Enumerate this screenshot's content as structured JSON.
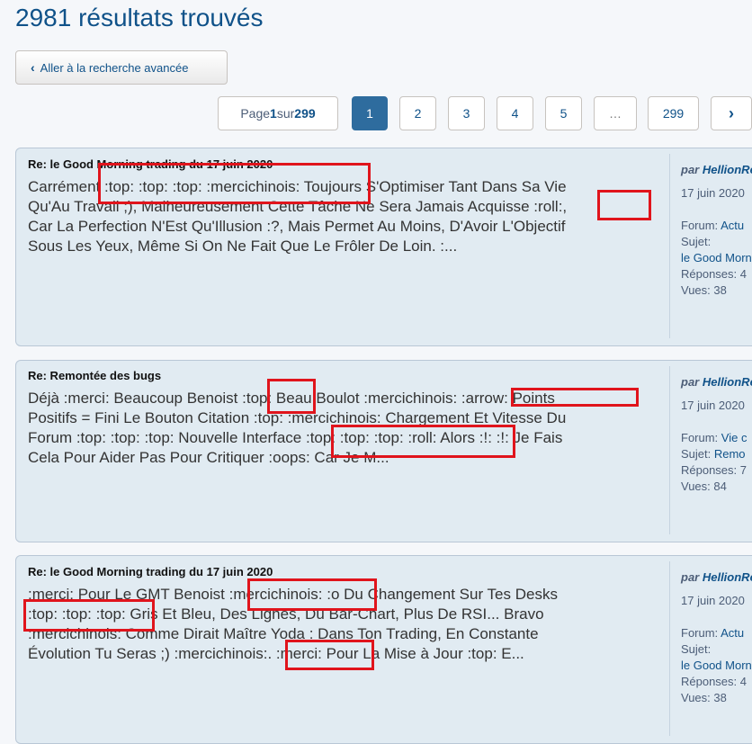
{
  "header": {
    "title": "2981 résultats trouvés"
  },
  "advanced_search": {
    "label": "Aller à la recherche avancée"
  },
  "pagination": {
    "info_prefix": "Page ",
    "current": "1",
    "info_mid": " sur ",
    "total": "299",
    "pages": [
      "1",
      "2",
      "3",
      "4",
      "5",
      "…",
      "299"
    ],
    "next_symbol": "›"
  },
  "posts": [
    {
      "title": "Re: le Good Morning trading du 17 juin 2020",
      "lines": [
        "Carrément :top: :top: :top: :mercichinois: Toujours S'Optimiser Tant Dans Sa Vie",
        "Qu'Au Travail ;), Malheureusement Cette Tâche Ne Sera Jamais Acquisse :roll:,",
        "Car La Perfection N'Est Qu'Illusion :?, Mais Permet Au Moins, D'Avoir L'Objectif",
        "Sous Les Yeux, Même Si On Ne Fait Que Le Frôler De Loin. :..."
      ],
      "by": "par ",
      "author": "HellionRe",
      "date": "17 juin 2020",
      "forum_label": "Forum: ",
      "forum": "Actu",
      "subject_label": "Sujet:",
      "subject": "le Good Morn",
      "replies": "Réponses: 4",
      "views": "Vues: 38"
    },
    {
      "title": "Re: Remontée des bugs",
      "lines": [
        "Déjà :merci: Beaucoup Benoist :top: Beau Boulot :mercichinois: :arrow: Points",
        "Positifs = Fini Le Bouton Citation :top: :mercichinois: Chargement Et Vitesse Du",
        "Forum :top: :top: :top: Nouvelle Interface :top: :top: :top: :roll: Alors :!: :!: Je Fais",
        "Cela Pour Aider Pas Pour Critiquer :oops: Car Je M..."
      ],
      "by": "par ",
      "author": "HellionRe",
      "date": "17 juin 2020",
      "forum_label": "Forum: ",
      "forum": "Vie c",
      "subject_label": "Sujet: ",
      "subject": "Remo",
      "replies": "Réponses: 7",
      "views": "Vues: 84"
    },
    {
      "title": "Re: le Good Morning trading du 17 juin 2020",
      "lines": [
        ":merci: Pour Le GMT Benoist :mercichinois: :o Du Changement Sur Tes Desks",
        ":top: :top: :top: Gris Et Bleu, Des Lignes, Du Bar-Chart, Plus De RSI... Bravo",
        ":mercichinois: Comme Dirait Maître Yoda : Dans Ton Trading, En Constante",
        "Évolution Tu Seras ;) :mercichinois:. :merci: Pour La Mise à Jour :top: E..."
      ],
      "by": "par ",
      "author": "HellionRe",
      "date": "17 juin 2020",
      "forum_label": "Forum: ",
      "forum": "Actu",
      "subject_label": "Sujet:",
      "subject": "le Good Morn",
      "replies": "Réponses: 4",
      "views": "Vues: 38"
    }
  ],
  "colors": {
    "title": "#105289",
    "post_bg": "#e1ebf2",
    "active_page": "#2e6c9e",
    "highlight": "#e0141c"
  }
}
